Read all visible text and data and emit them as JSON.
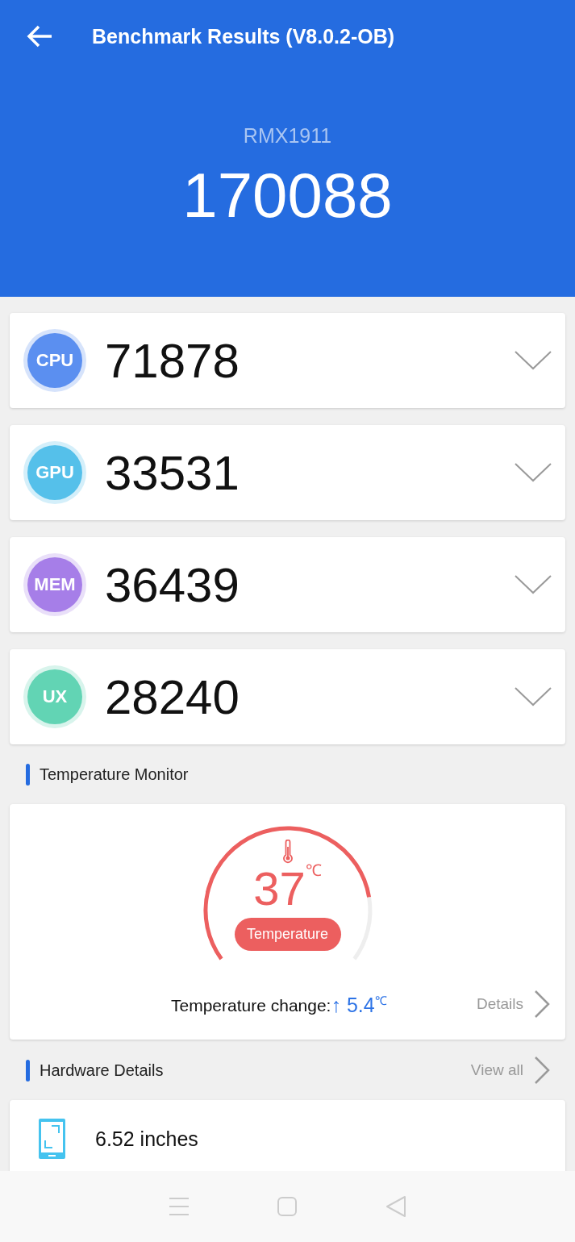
{
  "header": {
    "title": "Benchmark Results (V8.0.2-OB)",
    "device": "RMX1911",
    "total_score": "170088"
  },
  "scores": [
    {
      "label": "CPU",
      "value": "71878",
      "color": "#5b8ff0"
    },
    {
      "label": "GPU",
      "value": "33531",
      "color": "#55c0ea"
    },
    {
      "label": "MEM",
      "value": "36439",
      "color": "#a67ee8"
    },
    {
      "label": "UX",
      "value": "28240",
      "color": "#62d4b4"
    }
  ],
  "temperature": {
    "heading": "Temperature Monitor",
    "value": "37",
    "unit": "℃",
    "badge": "Temperature",
    "change_label": "Temperature change:",
    "change_arrow": "↑",
    "change_value": "5.4",
    "change_unit": "℃",
    "details": "Details"
  },
  "hardware": {
    "heading": "Hardware Details",
    "view_all": "View all",
    "items": [
      {
        "text": "6.52 inches"
      }
    ]
  }
}
